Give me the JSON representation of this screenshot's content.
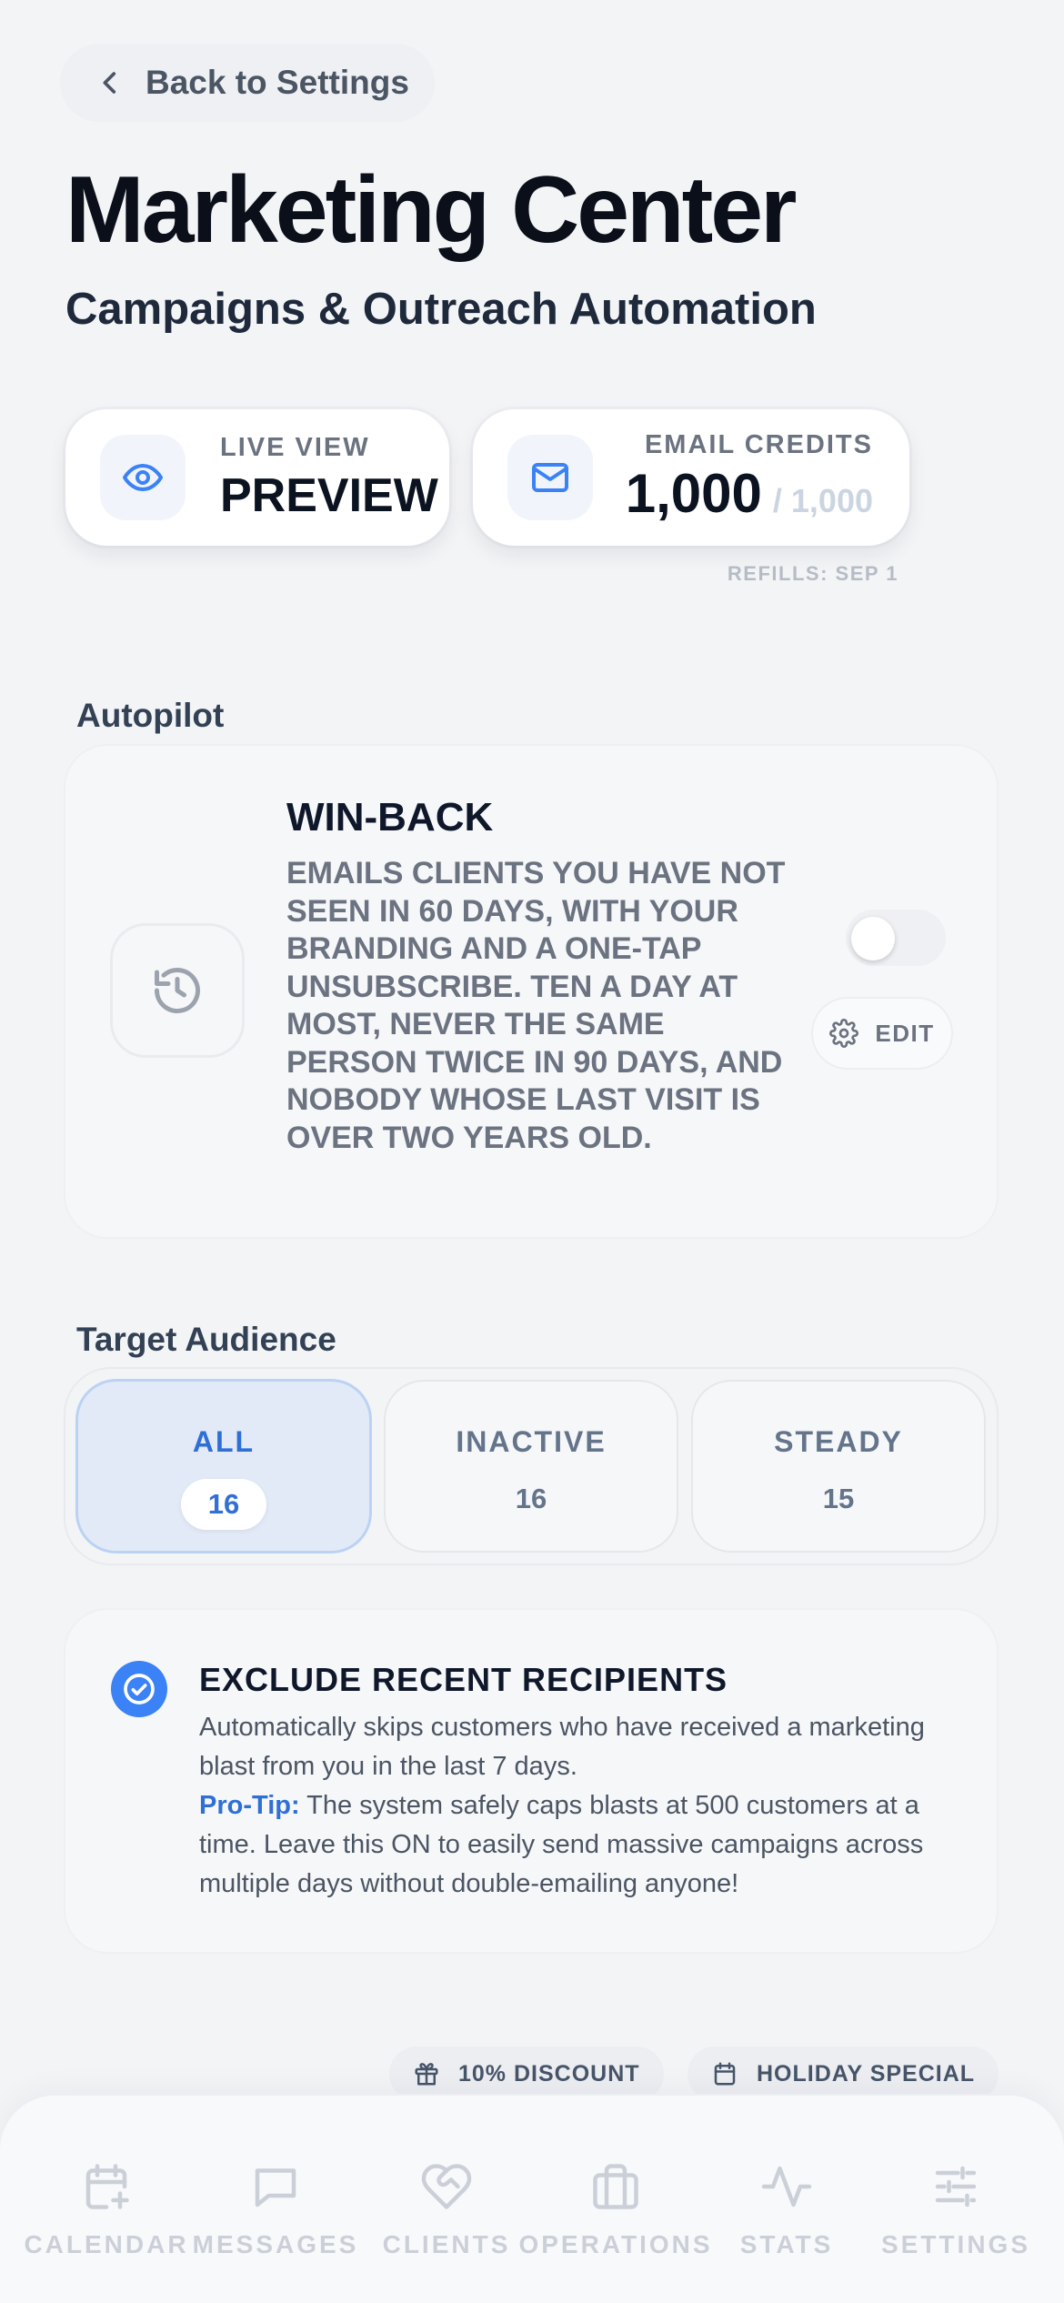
{
  "header": {
    "back_label": "Back to Settings",
    "title": "Marketing Center",
    "subtitle": "Campaigns & Outreach Automation"
  },
  "stats": {
    "preview": {
      "label": "LIVE VIEW",
      "value": "PREVIEW",
      "icon": "eye-icon"
    },
    "credits": {
      "label": "EMAIL CREDITS",
      "value": "1,000",
      "total": "/ 1,000",
      "icon": "mail-icon"
    },
    "refills": "REFILLS: SEP 1"
  },
  "autopilot": {
    "section_label": "Autopilot",
    "title": "WIN-BACK",
    "description": "Emails clients you have not seen in 60 days, with your branding and a one-tap unsubscribe. Ten a day at most, never the same person twice in 90 days, and nobody whose last visit is over two years old.",
    "toggle_on": false,
    "edit_label": "EDIT",
    "icon": "history-icon"
  },
  "audience": {
    "section_label": "Target Audience",
    "tabs": [
      {
        "name": "ALL",
        "count": "16",
        "active": true
      },
      {
        "name": "INACTIVE",
        "count": "16",
        "active": false
      },
      {
        "name": "STEADY",
        "count": "15",
        "active": false
      }
    ]
  },
  "exclude": {
    "title": "EXCLUDE RECENT RECIPIENTS",
    "body": "Automatically skips customers who have received a marketing blast from you in the last 7 days.",
    "protip_label": "Pro-Tip:",
    "protip_text": " The system safely caps blasts at 500 customers at a time. Leave this ON to easily send massive campaigns across multiple days without double-emailing anyone!",
    "enabled": true
  },
  "chips": [
    {
      "label": "10% DISCOUNT",
      "icon": "gift-icon"
    },
    {
      "label": "HOLIDAY SPECIAL",
      "icon": "calendar-icon"
    }
  ],
  "nav": [
    {
      "label": "CALENDAR",
      "icon": "calendar-plus-icon"
    },
    {
      "label": "MESSAGES",
      "icon": "message-icon"
    },
    {
      "label": "CLIENTS",
      "icon": "heart-handshake-icon"
    },
    {
      "label": "OPERATIONS",
      "icon": "briefcase-icon"
    },
    {
      "label": "STATS",
      "icon": "activity-icon"
    },
    {
      "label": "SETTINGS",
      "icon": "sliders-icon"
    }
  ],
  "colors": {
    "accent": "#3b82f6",
    "accent_text": "#2f6fd6",
    "background": "#f3f4f6"
  }
}
